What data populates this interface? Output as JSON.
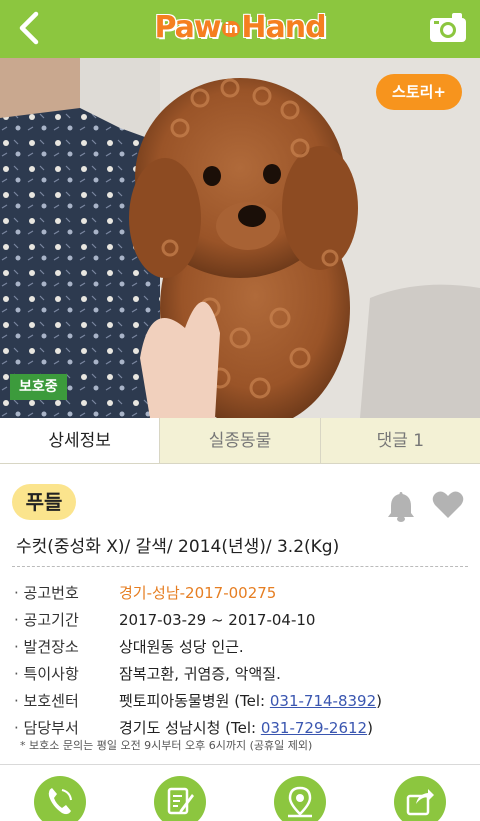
{
  "header": {
    "logo_text": "PawinHand",
    "logo_part1": "Paw",
    "logo_part2": "in",
    "logo_part3": "Hand"
  },
  "photo": {
    "story_button": "스토리+",
    "status_tag": "보호중"
  },
  "tabs": [
    {
      "label": "상세정보",
      "active": true
    },
    {
      "label": "실종동물",
      "active": false
    },
    {
      "label": "댓글 1",
      "active": false
    }
  ],
  "animal": {
    "breed": "푸들",
    "summary": "수컷(중성화 X)/ 갈색/ 2014(년생)/ 3.2(Kg)"
  },
  "info": {
    "notice_no_label": "공고번호",
    "notice_no": "경기-성남-2017-00275",
    "period_label": "공고기간",
    "period": "2017-03-29 ~ 2017-04-10",
    "found_place_label": "발견장소",
    "found_place": "상대원동 성당 인근.",
    "features_label": "특이사항",
    "features": "잠복고환, 귀염증, 악액질.",
    "center_label": "보호센터",
    "center_name": "펫토피아동물병원",
    "center_tel_prefix": "(Tel: ",
    "center_tel": "031-714-8392",
    "center_tel_suffix": ")",
    "dept_label": "담당부서",
    "dept_name": "경기도 성남시청",
    "dept_tel_prefix": "(Tel: ",
    "dept_tel": "031-729-2612",
    "dept_tel_suffix": ")"
  },
  "note": "* 보호소 문의는 평일 오전 9시부터 오후 6시까지 (공휴일 제외)",
  "colors": {
    "brand_green": "#8cc63f",
    "accent_orange": "#f7941d",
    "tag_green": "#3c9b3c",
    "badge_yellow": "#fbe48d",
    "link_blue": "#3a56b0"
  },
  "icons": {
    "back": "back-arrow-icon",
    "camera": "camera-icon",
    "bell": "bell-icon",
    "heart": "heart-icon",
    "call": "phone-icon",
    "write": "write-icon",
    "map": "map-pin-icon",
    "share": "share-icon"
  }
}
